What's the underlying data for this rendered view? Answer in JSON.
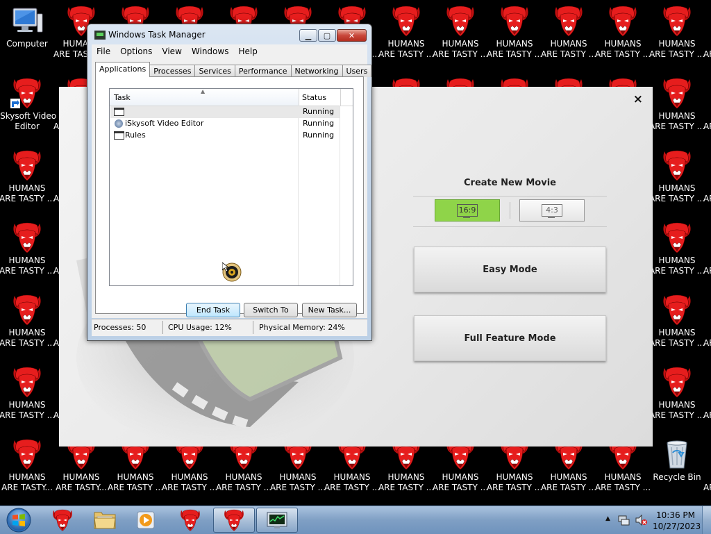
{
  "desktop": {
    "system_icons": [
      {
        "id": "computer",
        "label": "Computer",
        "icon": "computer-icon"
      },
      {
        "id": "iskysoft",
        "label": "iSkysoft Video Editor",
        "icon": "iskysoft-shortcut-icon"
      },
      {
        "id": "recycle-bin",
        "label": "Recycle Bin",
        "icon": "recycle-bin-icon"
      }
    ],
    "repeated_icon": {
      "label": "HUMANS\nARE TASTY ...",
      "label_alt": "HUMANS\nARE TASTY...",
      "icon": "red-demon-icon"
    }
  },
  "iskysoft_window": {
    "close_symbol": "×",
    "create_title": "Create New Movie",
    "ratio_169": "16:9",
    "ratio_43": "4:3",
    "selected_ratio": "16:9",
    "easy_mode": "Easy Mode",
    "full_mode": "Full Feature Mode",
    "accent_color": "#8fd449"
  },
  "task_manager": {
    "title": "Windows Task Manager",
    "caption": {
      "minimize": "▁",
      "maximize": "▢",
      "close": "✕"
    },
    "menu": [
      "File",
      "Options",
      "View",
      "Windows",
      "Help"
    ],
    "tabs": [
      "Applications",
      "Processes",
      "Services",
      "Performance",
      "Networking",
      "Users"
    ],
    "active_tab": "Applications",
    "columns": {
      "task": "Task",
      "status": "Status"
    },
    "rows": [
      {
        "name": "",
        "status": "Running",
        "icon": "window-icon",
        "selected": true
      },
      {
        "name": "iSkysoft Video Editor",
        "status": "Running",
        "icon": "iskysoft-icon",
        "selected": false
      },
      {
        "name": "Rules",
        "status": "Running",
        "icon": "window-icon",
        "selected": false
      }
    ],
    "buttons": {
      "end_task": "End Task",
      "switch_to": "Switch To",
      "new_task": "New Task..."
    },
    "status_bar": {
      "processes": "Processes: 50",
      "cpu": "CPU Usage: 12%",
      "memory": "Physical Memory: 24%"
    }
  },
  "taskbar": {
    "items": [
      {
        "name": "taskbar-demon",
        "icon": "red-demon-icon"
      },
      {
        "name": "taskbar-explorer",
        "icon": "folder-icon"
      },
      {
        "name": "taskbar-media-player",
        "icon": "media-player-icon"
      },
      {
        "name": "taskbar-demon-2",
        "icon": "red-demon-icon"
      },
      {
        "name": "taskbar-demon-3",
        "icon": "red-demon-icon",
        "active": true
      },
      {
        "name": "taskbar-task-manager",
        "icon": "task-manager-icon",
        "active": true
      }
    ],
    "clock": {
      "time": "10:36 PM",
      "date": "10/27/2023"
    },
    "tray_icons": [
      "show-hidden-icons-arrow",
      "network-icon",
      "volume-muted-icon"
    ]
  }
}
